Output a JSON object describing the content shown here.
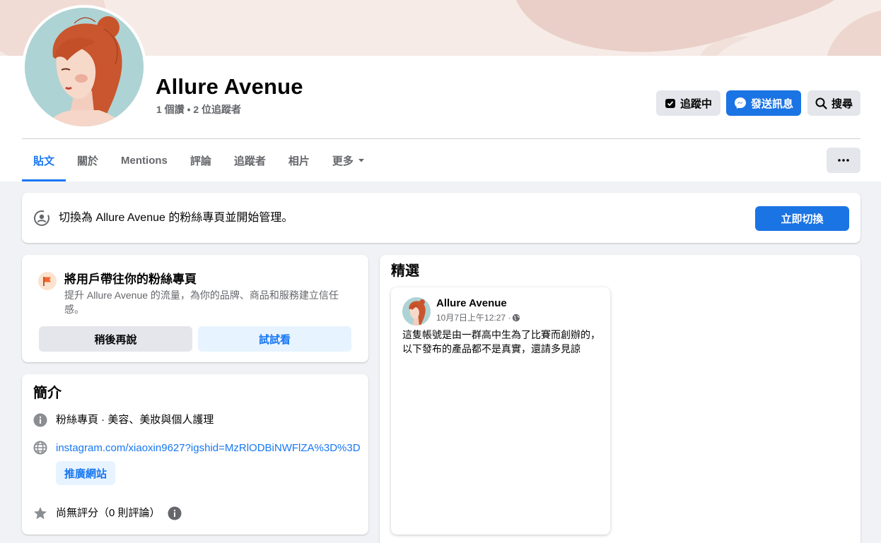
{
  "page": {
    "name": "Allure Avenue",
    "stats": "1 個讚 • 2 位追蹤者"
  },
  "header_buttons": {
    "following": "追蹤中",
    "message": "發送訊息",
    "search": "搜尋"
  },
  "tabs": [
    {
      "label": "貼文",
      "active": true
    },
    {
      "label": "關於"
    },
    {
      "label": "Mentions"
    },
    {
      "label": "評論"
    },
    {
      "label": "追蹤者"
    },
    {
      "label": "相片"
    },
    {
      "label": "更多"
    }
  ],
  "switch_banner": {
    "text": "切換為 Allure Avenue 的粉絲專頁並開始管理。",
    "button": "立即切換"
  },
  "promo": {
    "title": "將用戶帶往你的粉絲專頁",
    "description": "提升 Allure Avenue 的流量，為你的品牌、商品和服務建立信任感。",
    "later_button": "稍後再說",
    "try_button": "試試看"
  },
  "intro": {
    "title": "簡介",
    "category": "粉絲專頁 · 美容、美妝與個人護理",
    "link": "instagram.com/xiaoxin9627?igshid=MzRlODBiNWFlZA%3D%3D",
    "promote_button": "推廣網站",
    "rating": "尚無評分（0 則評論）"
  },
  "featured": {
    "title": "精選",
    "post": {
      "author": "Allure Avenue",
      "time": "10月7日上午12:27 ·",
      "body": "這隻帳號是由一群高中生為了比賽而創辦的，以下發布的產品都不是真實，還請多見諒"
    }
  },
  "colors": {
    "brand_blue": "#1b74e4",
    "link_blue": "#1877f2",
    "avatar_bg": "#aed3d4",
    "cover_bg": "#f4e8e4"
  }
}
